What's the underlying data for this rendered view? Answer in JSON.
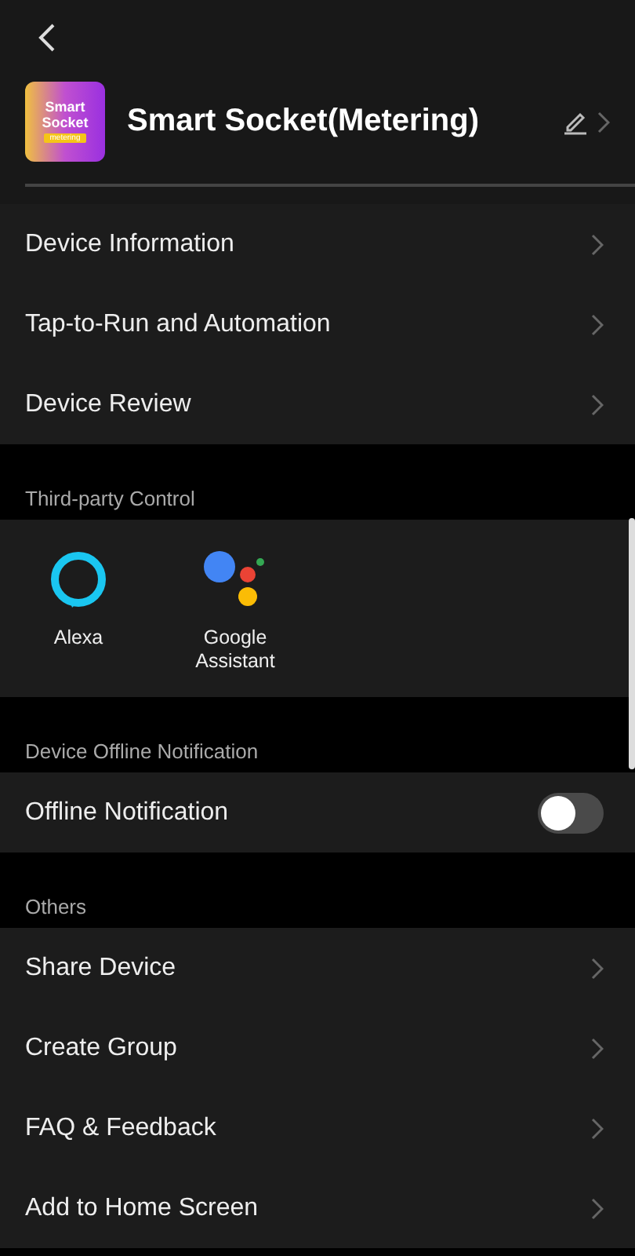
{
  "header": {
    "logo": {
      "title": "Smart Socket",
      "badge": "metering"
    },
    "title": "Smart Socket(Metering)"
  },
  "sections": [
    {
      "kind": "nav",
      "items": [
        {
          "label": "Device Information"
        },
        {
          "label": "Tap-to-Run and Automation"
        },
        {
          "label": "Device Review"
        }
      ]
    },
    {
      "kind": "integrations",
      "heading": "Third-party Control",
      "items": [
        {
          "kind": "alexa",
          "label": "Alexa"
        },
        {
          "kind": "assistant",
          "label": "Google Assistant"
        }
      ]
    },
    {
      "kind": "toggle",
      "heading": "Device Offline Notification",
      "items": [
        {
          "label": "Offline Notification",
          "on": false
        }
      ]
    },
    {
      "kind": "nav",
      "heading": "Others",
      "items": [
        {
          "label": "Share Device"
        },
        {
          "label": "Create Group"
        },
        {
          "label": "FAQ & Feedback"
        },
        {
          "label": "Add to Home Screen"
        }
      ]
    }
  ]
}
